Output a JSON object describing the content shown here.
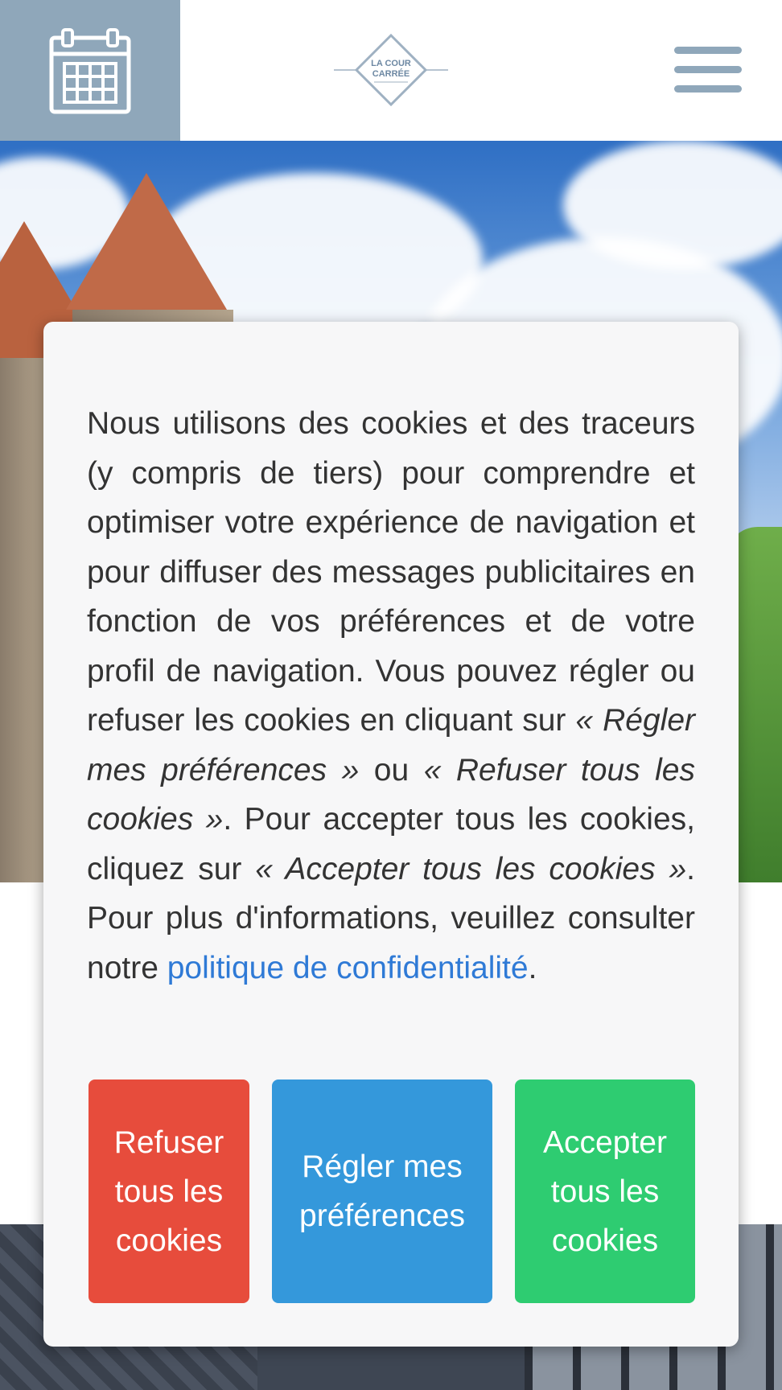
{
  "header": {
    "calendar_icon": "calendar-icon",
    "logo_line1": "LA COUR",
    "logo_line2": "CARRÉE",
    "menu_icon": "hamburger-menu-icon"
  },
  "cookie_banner": {
    "text_part1": "Nous utilisons des cookies et des traceurs (y compris de tiers) pour comprendre et optimiser votre expérience de navigation et pour diffuser des messages publicitaires en fonction de vos préférences et de votre profil de navigation. Vous pouvez régler ou refuser les cookies en cliquant sur ",
    "text_em1": "« Régler mes préférences »",
    "text_part2": " ou ",
    "text_em2": "« Refuser tous les cookies »",
    "text_part3": ". Pour accepter tous les cookies, cliquez sur ",
    "text_em3": "« Accepter tous les cookies »",
    "text_part4": ". Pour plus d'informations, veuillez consulter notre ",
    "privacy_link": "politique de confidentialité",
    "text_end": ".",
    "refuse_button": "Refuser tous les cookies",
    "settings_button": "Régler mes préférences",
    "accept_button": "Accepter tous les cookies"
  },
  "colors": {
    "header_accent": "#8fa7ba",
    "refuse": "#e74c3c",
    "settings": "#3498db",
    "accept": "#2ecc71",
    "link": "#2f7ad6"
  }
}
